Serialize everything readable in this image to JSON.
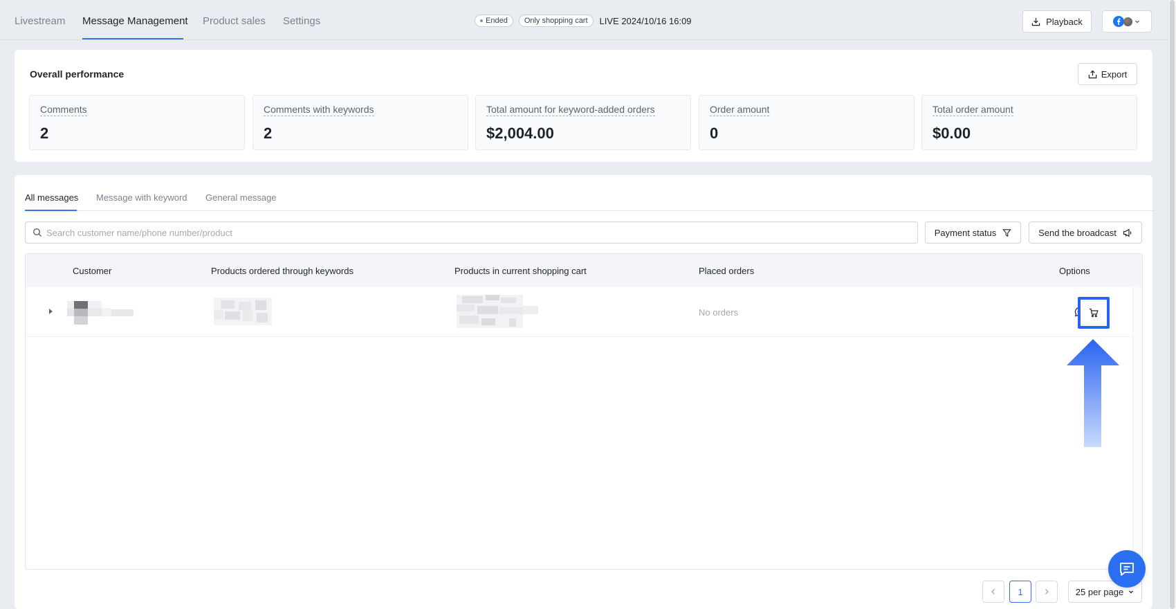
{
  "nav": {
    "tabs": [
      {
        "label": "Livestream"
      },
      {
        "label": "Message Management"
      },
      {
        "label": "Product sales"
      },
      {
        "label": "Settings"
      }
    ],
    "active_index": 1
  },
  "status": {
    "ended_label": "Ended",
    "cart_label": "Only shopping cart",
    "live_text": "LIVE 2024/10/16 16:09"
  },
  "header_actions": {
    "playback_label": "Playback"
  },
  "performance": {
    "title": "Overall performance",
    "export_label": "Export",
    "stats": [
      {
        "label": "Comments",
        "value": "2"
      },
      {
        "label": "Comments with keywords",
        "value": "2"
      },
      {
        "label": "Total amount for keyword-added orders",
        "value": "$2,004.00"
      },
      {
        "label": "Order amount",
        "value": "0"
      },
      {
        "label": "Total order amount",
        "value": "$0.00"
      }
    ]
  },
  "messages": {
    "tabs": [
      {
        "label": "All messages"
      },
      {
        "label": "Message with keyword"
      },
      {
        "label": "General message"
      }
    ],
    "active_tab": 0,
    "search": {
      "placeholder": "Search customer name/phone number/product",
      "value": ""
    },
    "payment_status_label": "Payment status",
    "broadcast_label": "Send the broadcast",
    "table": {
      "columns": [
        "Customer",
        "Products ordered through keywords",
        "Products in current shopping cart",
        "Placed orders",
        "Options"
      ],
      "rows": [
        {
          "placed_orders": "No orders"
        }
      ]
    }
  },
  "pagination": {
    "current_page": "1",
    "per_page_label": "25 per page"
  },
  "colors": {
    "accent": "#3a6df0",
    "highlight": "#2a63f0",
    "background": "#e9ecf1"
  },
  "icons": [
    "download-icon",
    "facebook-icon",
    "chevron-down-icon",
    "export-icon",
    "search-icon",
    "filter-icon",
    "megaphone-icon",
    "chat-bubble-icon",
    "cart-icon",
    "chevron-left-icon",
    "chevron-right-icon",
    "support-chat-icon"
  ]
}
